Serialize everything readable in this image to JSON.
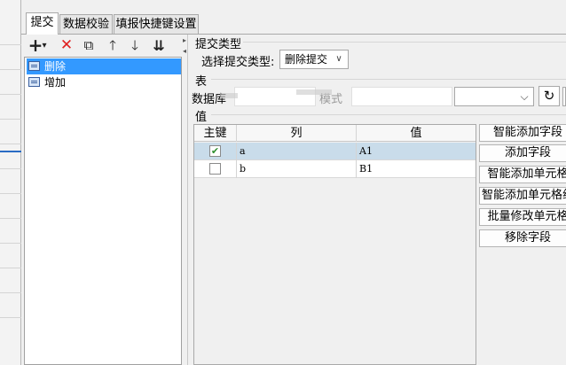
{
  "tabs": [
    {
      "label": "提交"
    },
    {
      "label": "数据校验"
    },
    {
      "label": "填报快捷键设置"
    }
  ],
  "toolbar": {
    "add_icon": "+",
    "add_dropdown_icon": "▾",
    "delete_icon": "✕",
    "copy_icon": "⧉",
    "up_icon": "🡑",
    "down_icon": "🡓",
    "sort_icon": "⇊"
  },
  "tree": {
    "items": [
      {
        "label": "删除",
        "selected": true
      },
      {
        "label": "增加",
        "selected": false
      }
    ]
  },
  "submit_type": {
    "section_label": "提交类型",
    "field_label": "选择提交类型:",
    "value": "删除提交",
    "dropdown_icon": "∨"
  },
  "table_section": {
    "section_label": "表",
    "db_label": "数据库",
    "schema_label": "模式",
    "refresh_icon": "↻"
  },
  "value_section": {
    "section_label": "值",
    "columns": [
      "主键",
      "列",
      "值"
    ],
    "rows": [
      {
        "key": true,
        "col": "a",
        "val": "A1",
        "selected": true
      },
      {
        "key": false,
        "col": "b",
        "val": "B1",
        "selected": false
      }
    ],
    "check_mark": "✔"
  },
  "actions": [
    {
      "label": "智能添加字段"
    },
    {
      "label": "添加字段"
    },
    {
      "label": "智能添加单元格"
    },
    {
      "label": "智能添加单元格组"
    },
    {
      "label": "批量修改单元格"
    },
    {
      "label": "移除字段"
    }
  ]
}
